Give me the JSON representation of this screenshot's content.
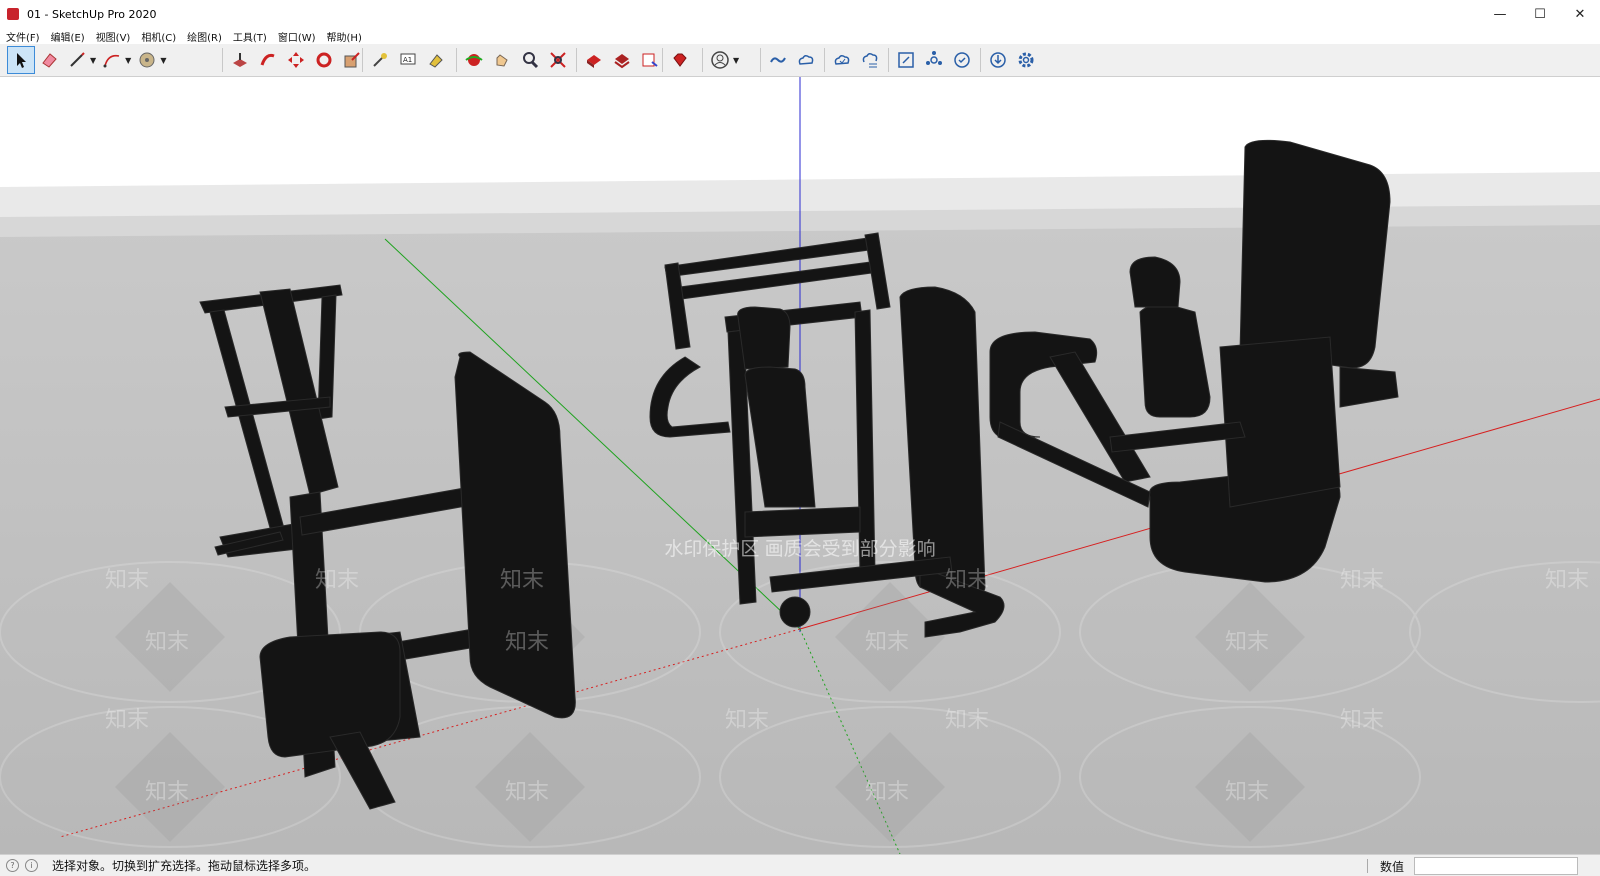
{
  "window": {
    "title": "01 - SketchUp Pro 2020",
    "controls": {
      "minimize": "—",
      "maximize": "☐",
      "close": "✕"
    }
  },
  "menu": [
    "文件(F)",
    "编辑(E)",
    "视图(V)",
    "相机(C)",
    "绘图(R)",
    "工具(T)",
    "窗口(W)",
    "帮助(H)"
  ],
  "toolbar": {
    "tools": [
      "select-icon",
      "eraser-icon",
      "pencil-icon",
      "arc-icon",
      "paint-bucket-icon",
      "push-pull-icon",
      "follow-me-icon",
      "move-icon",
      "rotate-icon",
      "scale-icon",
      "tape-measure-icon",
      "text-icon",
      "paint-icon",
      "orbit-icon",
      "pan-icon",
      "zoom-icon",
      "zoom-extents-icon",
      "warehouse-icon",
      "extension-warehouse-icon",
      "layout-icon",
      "ruby-icon",
      "account-icon",
      "trimble-connect-icon",
      "collaborate-icon",
      "cloud-sync-icon",
      "cloud-list-icon",
      "fit-icon",
      "sandbox-icon",
      "update-icon",
      "download-icon",
      "settings-icon"
    ]
  },
  "viewport": {
    "watermark_main": "水印保护区 画质会受到部分影响",
    "watermark_logo": "知末",
    "colors": {
      "sky": "#ffffff",
      "ground": "#bfbfbf",
      "model": "#121212",
      "axis_red": "#d62020",
      "axis_green": "#1fa31f",
      "axis_blue": "#2a2ad0"
    }
  },
  "status": {
    "message": "选择对象。切换到扩充选择。拖动鼠标选择多项。",
    "value_label": "数值",
    "value": ""
  }
}
